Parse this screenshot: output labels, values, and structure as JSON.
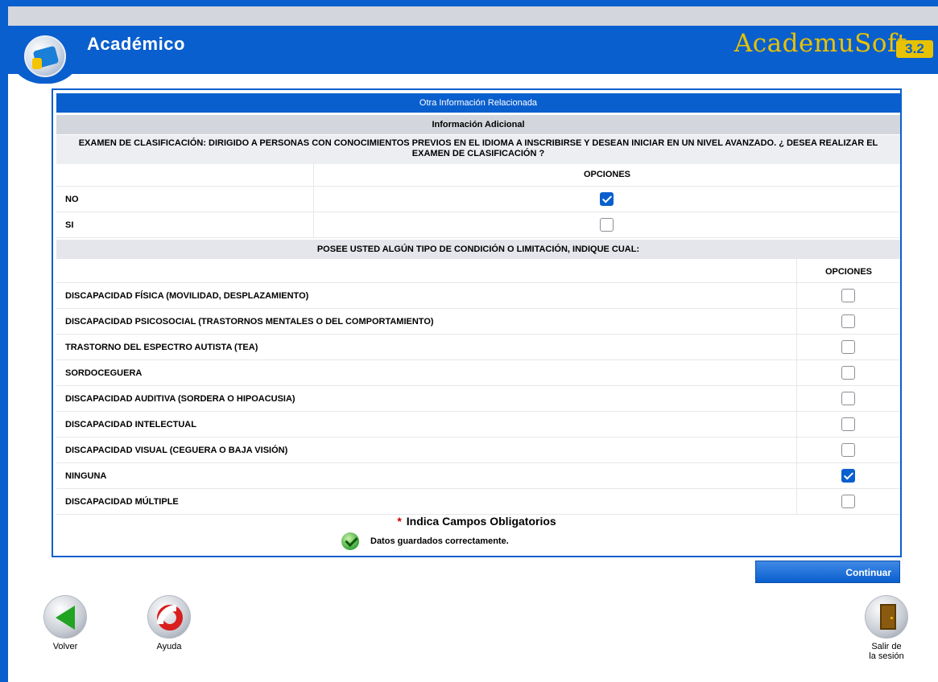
{
  "header": {
    "app_title": "Académico",
    "brand_name": "AcademuSoft",
    "brand_version": "3.2"
  },
  "form": {
    "section_title": "Otra Información Relacionada",
    "subsection_title": "Información Adicional",
    "exam_question": "EXAMEN DE CLASIFICACIÓN: DIRIGIDO A PERSONAS CON CONOCIMIENTOS PREVIOS EN EL IDIOMA A INSCRIBIRSE Y DESEAN INICIAR EN UN NIVEL AVANZADO. ¿ DESEA REALIZAR EL EXAMEN DE CLASIFICACIÓN ?",
    "exam_options_header": "OPCIONES",
    "exam_options": [
      {
        "label": "NO",
        "checked": true
      },
      {
        "label": "SI",
        "checked": false
      }
    ],
    "condition_question": "POSEE USTED ALGÚN TIPO DE CONDICIÓN O LIMITACIÓN, INDIQUE CUAL:",
    "condition_options_header": "OPCIONES",
    "conditions": [
      {
        "label": "DISCAPACIDAD FÍSICA (MOVILIDAD, DESPLAZAMIENTO)",
        "checked": false
      },
      {
        "label": "DISCAPACIDAD PSICOSOCIAL (TRASTORNOS MENTALES O DEL COMPORTAMIENTO)",
        "checked": false
      },
      {
        "label": "TRASTORNO DEL ESPECTRO AUTISTA (TEA)",
        "checked": false
      },
      {
        "label": "SORDOCEGUERA",
        "checked": false
      },
      {
        "label": "DISCAPACIDAD AUDITIVA (SORDERA O HIPOACUSIA)",
        "checked": false
      },
      {
        "label": "DISCAPACIDAD INTELECTUAL",
        "checked": false
      },
      {
        "label": "DISCAPACIDAD VISUAL (CEGUERA O BAJA VISIÓN)",
        "checked": false
      },
      {
        "label": "NINGUNA",
        "checked": true
      },
      {
        "label": "DISCAPACIDAD MÚLTIPLE",
        "checked": false
      }
    ],
    "required_star": "*",
    "required_note": "Indica Campos Obligatorios",
    "saved_message": "Datos guardados correctamente."
  },
  "actions": {
    "continue_label": "Continuar",
    "back_label": "Volver",
    "help_label": "Ayuda",
    "logout_line1": "Salir de",
    "logout_line2": "la sesión"
  },
  "colors": {
    "primary_blue": "#0a5fce",
    "brand_gold": "#e8c200",
    "header_grey": "#d3d6dd",
    "required_red": "#d10000"
  },
  "icons": [
    "academic-logo-icon",
    "success-check-icon",
    "back-arrow-icon",
    "help-lifebuoy-icon",
    "logout-door-icon"
  ]
}
